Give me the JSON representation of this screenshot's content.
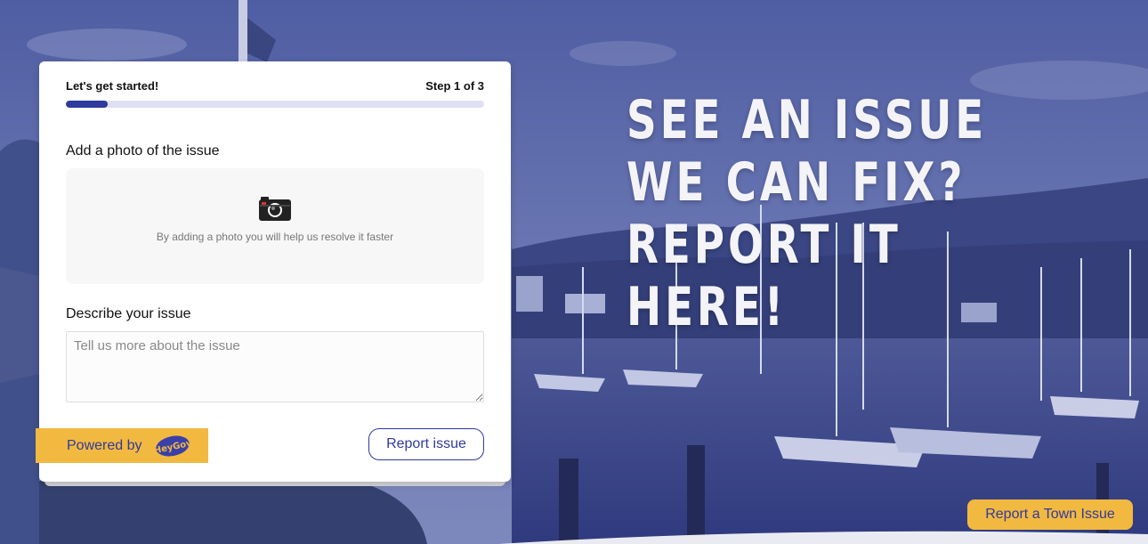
{
  "hero": {
    "headline": "SEE AN ISSUE WE CAN FIX? REPORT IT HERE!"
  },
  "form": {
    "intro": "Let's get started!",
    "step": "Step 1 of 3",
    "progress_fraction": 0.1,
    "photo_label": "Add a photo of the issue",
    "photo_hint": "By adding a photo you will help us resolve it faster",
    "photo_icon": "camera-icon",
    "describe_label": "Describe your issue",
    "describe_placeholder": "Tell us more about the issue",
    "submit_label": "Report issue"
  },
  "footer": {
    "powered_by": "Powered by",
    "logo_text": "HeyGov",
    "town_button": "Report a Town Issue"
  },
  "colors": {
    "accent": "#2f3a9d",
    "yellow": "#f2b940",
    "tint": "#5a67a6"
  }
}
